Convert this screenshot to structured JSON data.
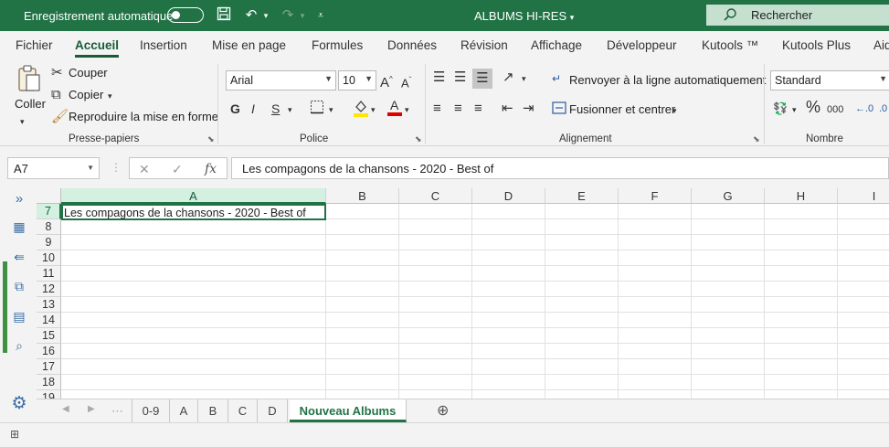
{
  "titlebar": {
    "autosave_label": "Enregistrement automatique",
    "doc_title": "ALBUMS HI-RES",
    "doc_title_chevron": "▾",
    "search_placeholder": "Rechercher"
  },
  "tabs": [
    "Fichier",
    "Accueil",
    "Insertion",
    "Mise en page",
    "Formules",
    "Données",
    "Révision",
    "Affichage",
    "Développeur",
    "Kutools ™",
    "Kutools Plus",
    "Aid"
  ],
  "ribbon": {
    "clipboard": {
      "paste": "Coller",
      "cut": "Couper",
      "copy": "Copier",
      "format_painter": "Reproduire la mise en forme",
      "label": "Presse-papiers"
    },
    "font": {
      "family": "Arial",
      "size": "10",
      "bold": "G",
      "italic": "I",
      "underline": "S",
      "label": "Police"
    },
    "alignment": {
      "wrap": "Renvoyer à la ligne automatiquement",
      "merge": "Fusionner et centrer",
      "label": "Alignement"
    },
    "number": {
      "format": "Standard",
      "percent": "%",
      "thousands": "000",
      "label": "Nombre"
    }
  },
  "formula": {
    "name_box": "A7",
    "fx": "fx",
    "content": "Les compagons de la chansons - 2020 - Best of"
  },
  "grid": {
    "columns": [
      "A",
      "B",
      "C",
      "D",
      "E",
      "F",
      "G",
      "H",
      "I"
    ],
    "rows": [
      "7",
      "8",
      "9",
      "10",
      "11",
      "12",
      "13",
      "14",
      "15",
      "16",
      "17",
      "18",
      "19"
    ],
    "active_cell_text": "Les compagons de la chansons - 2020 - Best of"
  },
  "sheets": [
    "0-9",
    "A",
    "B",
    "C",
    "D",
    "Nouveau Albums"
  ],
  "sheet_add": "⊕"
}
